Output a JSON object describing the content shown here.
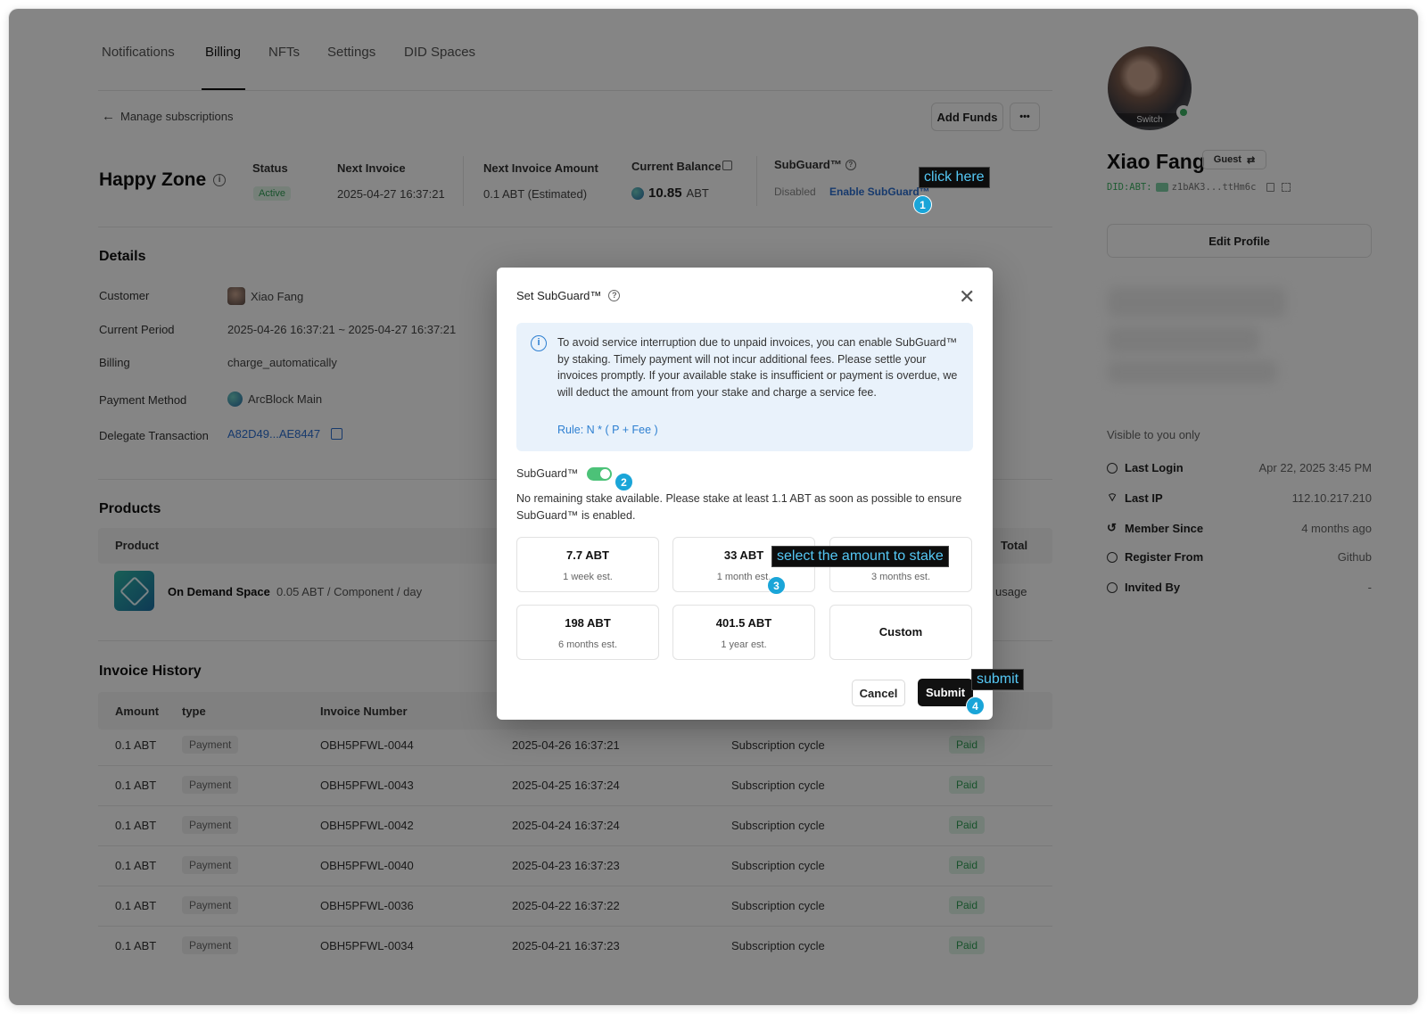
{
  "tabs": [
    "Notifications",
    "Billing",
    "NFTs",
    "Settings",
    "DID Spaces"
  ],
  "back_link": "Manage subscriptions",
  "buttons": {
    "add_funds": "Add Funds",
    "more": "•••"
  },
  "subscription": {
    "title": "Happy Zone",
    "status_label": "Status",
    "status": "Active",
    "next_invoice_label": "Next Invoice",
    "next_invoice": "2025-04-27 16:37:21",
    "next_invoice_amount_label": "Next Invoice Amount",
    "next_invoice_amount": "0.1 ABT (Estimated)",
    "balance_label": "Current Balance",
    "balance_value": "10.85",
    "balance_unit": "ABT",
    "subguard_label": "SubGuard™",
    "subguard_state": "Disabled",
    "subguard_enable": "Enable SubGuard™"
  },
  "details": {
    "title": "Details",
    "customer_label": "Customer",
    "customer": "Xiao Fang",
    "period_label": "Current Period",
    "period": "2025-04-26 16:37:21 ~ 2025-04-27 16:37:21",
    "billing_label": "Billing",
    "billing": "charge_automatically",
    "payment_label": "Payment Method",
    "payment": "ArcBlock Main",
    "delegate_label": "Delegate Transaction",
    "delegate": "A82D49...AE8447"
  },
  "products": {
    "title": "Products",
    "col_product": "Product",
    "col_total": "Total",
    "name": "On Demand Space",
    "price": "0.05 ABT / Component / day",
    "total": "usage"
  },
  "invoices": {
    "title": "Invoice History",
    "columns": [
      "Amount",
      "type",
      "Invoice Number"
    ],
    "rows": [
      {
        "amount": "0.1 ABT",
        "type": "Payment",
        "number": "OBH5PFWL-0044",
        "date": "2025-04-26 16:37:21",
        "desc": "Subscription cycle",
        "status": "Paid"
      },
      {
        "amount": "0.1 ABT",
        "type": "Payment",
        "number": "OBH5PFWL-0043",
        "date": "2025-04-25 16:37:24",
        "desc": "Subscription cycle",
        "status": "Paid"
      },
      {
        "amount": "0.1 ABT",
        "type": "Payment",
        "number": "OBH5PFWL-0042",
        "date": "2025-04-24 16:37:24",
        "desc": "Subscription cycle",
        "status": "Paid"
      },
      {
        "amount": "0.1 ABT",
        "type": "Payment",
        "number": "OBH5PFWL-0040",
        "date": "2025-04-23 16:37:23",
        "desc": "Subscription cycle",
        "status": "Paid"
      },
      {
        "amount": "0.1 ABT",
        "type": "Payment",
        "number": "OBH5PFWL-0036",
        "date": "2025-04-22 16:37:22",
        "desc": "Subscription cycle",
        "status": "Paid"
      },
      {
        "amount": "0.1 ABT",
        "type": "Payment",
        "number": "OBH5PFWL-0034",
        "date": "2025-04-21 16:37:23",
        "desc": "Subscription cycle",
        "status": "Paid"
      }
    ]
  },
  "profile": {
    "switch_label": "Switch",
    "name": "Xiao Fang",
    "role": "Guest",
    "did_prefix": "DID:ABT:",
    "did": "z1bAK3...ttHm6c",
    "edit_button": "Edit Profile",
    "visible_note": "Visible to you only",
    "meta": [
      {
        "key": "Last Login",
        "value": "Apr 22, 2025 3:45 PM",
        "icon": "clock-icon"
      },
      {
        "key": "Last IP",
        "value": "112.10.217.210",
        "icon": "antenna-icon"
      },
      {
        "key": "Member Since",
        "value": "4 months ago",
        "icon": "history-icon"
      },
      {
        "key": "Register From",
        "value": "Github",
        "icon": "globe-icon"
      },
      {
        "key": "Invited By",
        "value": "-",
        "icon": "globe-icon"
      }
    ]
  },
  "modal": {
    "title": "Set SubGuard™",
    "info_text": "To avoid service interruption due to unpaid invoices, you can enable SubGuard™ by staking. Timely payment will not incur additional fees. Please settle your invoices promptly. If your available stake is insufficient or payment is overdue, we will deduct the amount from your stake and charge a service fee.",
    "rule": "Rule: N * ( P + Fee )",
    "toggle_label": "SubGuard™",
    "toggle_on": true,
    "warning": "No remaining stake available. Please stake at least 1.1 ABT as soon as possible to ensure SubGuard™ is enabled.",
    "options": [
      {
        "amount": "7.7 ABT",
        "est": "1 week est."
      },
      {
        "amount": "33 ABT",
        "est": "1 month est."
      },
      {
        "amount": "",
        "est": "3 months est."
      },
      {
        "amount": "198 ABT",
        "est": "6 months est."
      },
      {
        "amount": "401.5 ABT",
        "est": "1 year est."
      }
    ],
    "custom_label": "Custom",
    "cancel": "Cancel",
    "submit": "Submit"
  },
  "annotations": {
    "click_here": "click here",
    "select_amount": "select the amount to stake",
    "submit": "submit",
    "steps": [
      "1",
      "2",
      "3",
      "4"
    ]
  },
  "colors": {
    "accent_link": "#2d6fd1",
    "success": "#2e9e54",
    "callout_text": "#55c8f5",
    "step_badge": "#1aa5d8"
  }
}
